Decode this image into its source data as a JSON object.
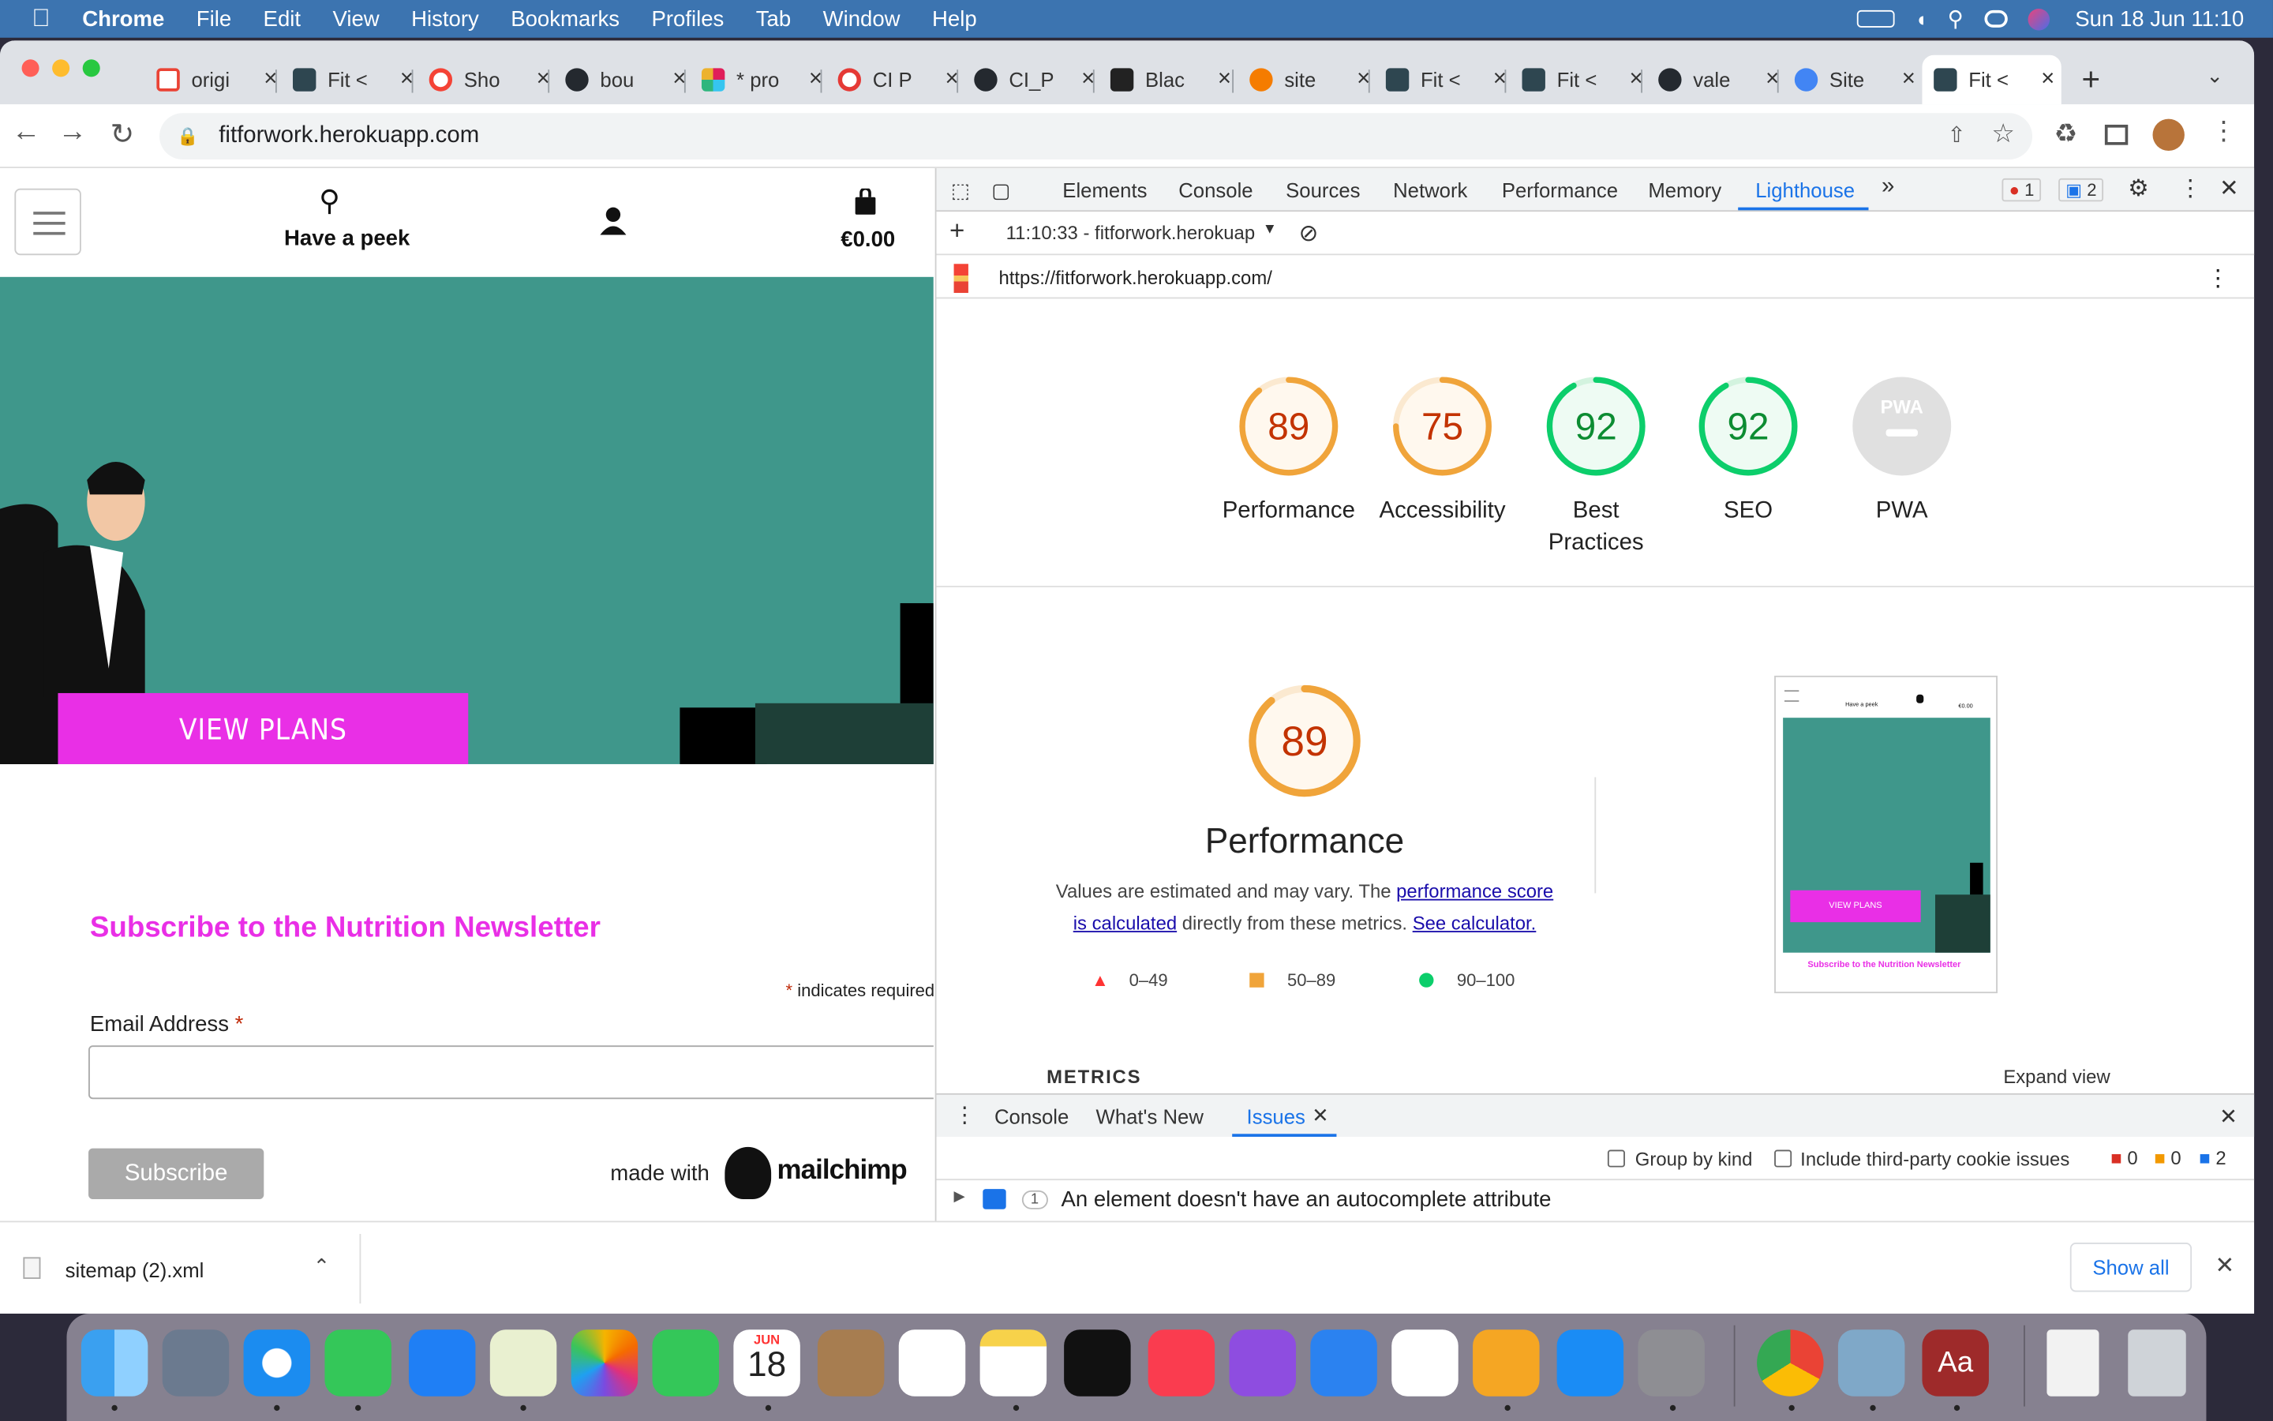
{
  "menubar": {
    "app": "Chrome",
    "items": [
      "File",
      "Edit",
      "View",
      "History",
      "Bookmarks",
      "Profiles",
      "Tab",
      "Window",
      "Help"
    ],
    "clock": "Sun 18 Jun  11:10"
  },
  "tabs": [
    {
      "label": "origi",
      "color": "#ea4335"
    },
    {
      "label": "Fit <",
      "color": "#2e4650"
    },
    {
      "label": "Sho",
      "color": "#f44336"
    },
    {
      "label": "bou",
      "color": "#24292f"
    },
    {
      "label": "* pro",
      "color": "#e01e5a"
    },
    {
      "label": "CI P",
      "color": "#e53935"
    },
    {
      "label": "CI_P",
      "color": "#24292f"
    },
    {
      "label": "Blac",
      "color": "#222222"
    },
    {
      "label": "site",
      "color": "#f57c00"
    },
    {
      "label": "Fit <",
      "color": "#2e4650"
    },
    {
      "label": "Fit <",
      "color": "#2e4650"
    },
    {
      "label": "vale",
      "color": "#24292f"
    },
    {
      "label": "Site",
      "color": "#4285f4"
    },
    {
      "label": "Fit <",
      "color": "#2e4650"
    }
  ],
  "omnibox": {
    "url": "fitforwork.herokuapp.com"
  },
  "site": {
    "search_label": "Have a peek",
    "cart_total": "€0.00",
    "cta": "VIEW PLANS",
    "newsletter_title": "Subscribe to the Nutrition Newsletter",
    "required_note": "indicates required",
    "email_label": "Email Address",
    "required_star": "*",
    "subscribe": "Subscribe",
    "made_with": "made with",
    "brand": "mailchimp"
  },
  "devtools": {
    "tabs": [
      "Elements",
      "Console",
      "Sources",
      "Network",
      "Performance",
      "Memory",
      "Lighthouse"
    ],
    "more": "»",
    "errors": "1",
    "messages": "2",
    "report_select": "11:10:33 - fitforwork.herokuap",
    "report_url": "https://fitforwork.herokuapp.com/",
    "scores": [
      {
        "label": "Performance",
        "value": "89",
        "score": 89,
        "color": "#f0a43a"
      },
      {
        "label": "Accessibility",
        "value": "75",
        "score": 75,
        "color": "#f0a43a"
      },
      {
        "label": "Best Practices",
        "value": "92",
        "score": 92,
        "color": "#0cce6b"
      },
      {
        "label": "SEO",
        "value": "92",
        "score": 92,
        "color": "#0cce6b"
      },
      {
        "label": "PWA",
        "value": "PWA",
        "score": 0,
        "color": "#cccccc"
      }
    ],
    "perf": {
      "score": "89",
      "score_num": 89,
      "title": "Performance",
      "desc_1": "Values are estimated and may vary. The ",
      "link_1": "performance score is calculated",
      "desc_2": " directly from these metrics. ",
      "link_2": "See calculator.",
      "legend": [
        "0–49",
        "50–89",
        "90–100"
      ]
    },
    "thumb": {
      "search": "Have a peek",
      "cart": "€0.00",
      "cta": "VIEW PLANS",
      "title": "Subscribe to the Nutrition Newsletter"
    },
    "metrics_heading": "METRICS",
    "expand": "Expand view",
    "drawer_tabs": [
      "Console",
      "What's New",
      "Issues"
    ],
    "group_by_kind": "Group by kind",
    "third_party": "Include third-party cookie issues",
    "counts": {
      "errors": "0",
      "warnings": "0",
      "info": "2"
    },
    "issue": {
      "count": "1",
      "text": "An element doesn't have an autocomplete attribute"
    }
  },
  "download": {
    "file": "sitemap (2).xml",
    "show_all": "Show all"
  },
  "dock": {
    "calendar_month": "JUN",
    "calendar_day": "18"
  }
}
